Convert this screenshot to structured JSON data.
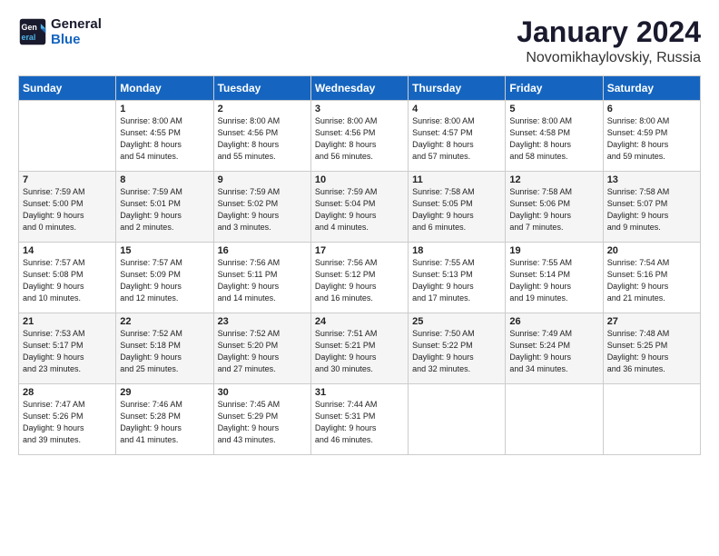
{
  "header": {
    "logo_line1": "General",
    "logo_line2": "Blue",
    "month_title": "January 2024",
    "subtitle": "Novomikhaylovskiy, Russia"
  },
  "columns": [
    "Sunday",
    "Monday",
    "Tuesday",
    "Wednesday",
    "Thursday",
    "Friday",
    "Saturday"
  ],
  "weeks": [
    [
      {
        "day": "",
        "info": ""
      },
      {
        "day": "1",
        "info": "Sunrise: 8:00 AM\nSunset: 4:55 PM\nDaylight: 8 hours\nand 54 minutes."
      },
      {
        "day": "2",
        "info": "Sunrise: 8:00 AM\nSunset: 4:56 PM\nDaylight: 8 hours\nand 55 minutes."
      },
      {
        "day": "3",
        "info": "Sunrise: 8:00 AM\nSunset: 4:56 PM\nDaylight: 8 hours\nand 56 minutes."
      },
      {
        "day": "4",
        "info": "Sunrise: 8:00 AM\nSunset: 4:57 PM\nDaylight: 8 hours\nand 57 minutes."
      },
      {
        "day": "5",
        "info": "Sunrise: 8:00 AM\nSunset: 4:58 PM\nDaylight: 8 hours\nand 58 minutes."
      },
      {
        "day": "6",
        "info": "Sunrise: 8:00 AM\nSunset: 4:59 PM\nDaylight: 8 hours\nand 59 minutes."
      }
    ],
    [
      {
        "day": "7",
        "info": "Sunrise: 7:59 AM\nSunset: 5:00 PM\nDaylight: 9 hours\nand 0 minutes."
      },
      {
        "day": "8",
        "info": "Sunrise: 7:59 AM\nSunset: 5:01 PM\nDaylight: 9 hours\nand 2 minutes."
      },
      {
        "day": "9",
        "info": "Sunrise: 7:59 AM\nSunset: 5:02 PM\nDaylight: 9 hours\nand 3 minutes."
      },
      {
        "day": "10",
        "info": "Sunrise: 7:59 AM\nSunset: 5:04 PM\nDaylight: 9 hours\nand 4 minutes."
      },
      {
        "day": "11",
        "info": "Sunrise: 7:58 AM\nSunset: 5:05 PM\nDaylight: 9 hours\nand 6 minutes."
      },
      {
        "day": "12",
        "info": "Sunrise: 7:58 AM\nSunset: 5:06 PM\nDaylight: 9 hours\nand 7 minutes."
      },
      {
        "day": "13",
        "info": "Sunrise: 7:58 AM\nSunset: 5:07 PM\nDaylight: 9 hours\nand 9 minutes."
      }
    ],
    [
      {
        "day": "14",
        "info": "Sunrise: 7:57 AM\nSunset: 5:08 PM\nDaylight: 9 hours\nand 10 minutes."
      },
      {
        "day": "15",
        "info": "Sunrise: 7:57 AM\nSunset: 5:09 PM\nDaylight: 9 hours\nand 12 minutes."
      },
      {
        "day": "16",
        "info": "Sunrise: 7:56 AM\nSunset: 5:11 PM\nDaylight: 9 hours\nand 14 minutes."
      },
      {
        "day": "17",
        "info": "Sunrise: 7:56 AM\nSunset: 5:12 PM\nDaylight: 9 hours\nand 16 minutes."
      },
      {
        "day": "18",
        "info": "Sunrise: 7:55 AM\nSunset: 5:13 PM\nDaylight: 9 hours\nand 17 minutes."
      },
      {
        "day": "19",
        "info": "Sunrise: 7:55 AM\nSunset: 5:14 PM\nDaylight: 9 hours\nand 19 minutes."
      },
      {
        "day": "20",
        "info": "Sunrise: 7:54 AM\nSunset: 5:16 PM\nDaylight: 9 hours\nand 21 minutes."
      }
    ],
    [
      {
        "day": "21",
        "info": "Sunrise: 7:53 AM\nSunset: 5:17 PM\nDaylight: 9 hours\nand 23 minutes."
      },
      {
        "day": "22",
        "info": "Sunrise: 7:52 AM\nSunset: 5:18 PM\nDaylight: 9 hours\nand 25 minutes."
      },
      {
        "day": "23",
        "info": "Sunrise: 7:52 AM\nSunset: 5:20 PM\nDaylight: 9 hours\nand 27 minutes."
      },
      {
        "day": "24",
        "info": "Sunrise: 7:51 AM\nSunset: 5:21 PM\nDaylight: 9 hours\nand 30 minutes."
      },
      {
        "day": "25",
        "info": "Sunrise: 7:50 AM\nSunset: 5:22 PM\nDaylight: 9 hours\nand 32 minutes."
      },
      {
        "day": "26",
        "info": "Sunrise: 7:49 AM\nSunset: 5:24 PM\nDaylight: 9 hours\nand 34 minutes."
      },
      {
        "day": "27",
        "info": "Sunrise: 7:48 AM\nSunset: 5:25 PM\nDaylight: 9 hours\nand 36 minutes."
      }
    ],
    [
      {
        "day": "28",
        "info": "Sunrise: 7:47 AM\nSunset: 5:26 PM\nDaylight: 9 hours\nand 39 minutes."
      },
      {
        "day": "29",
        "info": "Sunrise: 7:46 AM\nSunset: 5:28 PM\nDaylight: 9 hours\nand 41 minutes."
      },
      {
        "day": "30",
        "info": "Sunrise: 7:45 AM\nSunset: 5:29 PM\nDaylight: 9 hours\nand 43 minutes."
      },
      {
        "day": "31",
        "info": "Sunrise: 7:44 AM\nSunset: 5:31 PM\nDaylight: 9 hours\nand 46 minutes."
      },
      {
        "day": "",
        "info": ""
      },
      {
        "day": "",
        "info": ""
      },
      {
        "day": "",
        "info": ""
      }
    ]
  ]
}
